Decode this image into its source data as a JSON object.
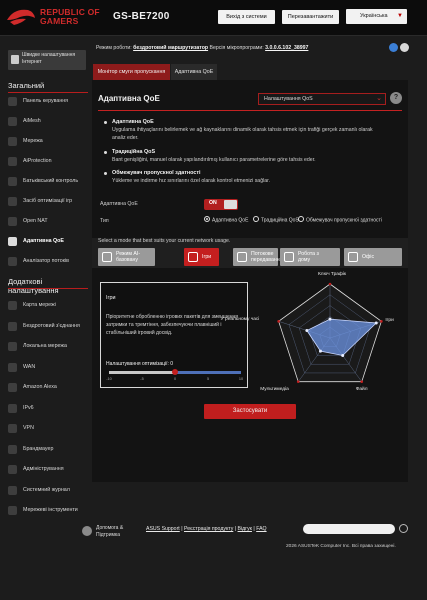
{
  "header": {
    "logo_line1": "REPUBLIC OF",
    "logo_line2": "GAMERS",
    "model": "GS-BE7200",
    "logout_label": "Вихід з системи",
    "reboot_label": "Перезавантажити",
    "language": "Українська"
  },
  "sidebar": {
    "first_item": "Швидке налаштування Інтернет",
    "general_heading": "Загальний",
    "general_items": [
      {
        "label": "Панель керування",
        "icon": "dashboard-icon"
      },
      {
        "label": "AiMesh",
        "icon": "aimesh-icon"
      },
      {
        "label": "Мережа",
        "icon": "network-icon"
      },
      {
        "label": "AiProtection",
        "icon": "shield-icon"
      },
      {
        "label": "Батьківський контроль",
        "icon": "parental-icon"
      },
      {
        "label": "Засіб оптимізації ігр",
        "icon": "game-boost-icon"
      },
      {
        "label": "Open NAT",
        "icon": "open-nat-icon"
      },
      {
        "label": "Адаптивна QoE",
        "icon": "qos-icon",
        "active": true
      },
      {
        "label": "Аналізатор потоків",
        "icon": "traffic-analyzer-icon"
      }
    ],
    "advanced_heading_1": "Додаткові",
    "advanced_heading_2": "налаштування",
    "advanced_items": [
      {
        "label": "Карта мережі",
        "icon": "network-map-icon"
      },
      {
        "label": "Бездротовий з'єднання",
        "icon": "wireless-icon"
      },
      {
        "label": "Локальна мережа",
        "icon": "lan-icon"
      },
      {
        "label": "WAN",
        "icon": "wan-icon"
      },
      {
        "label": "Amazon Alexa",
        "icon": "alexa-icon"
      },
      {
        "label": "IPv6",
        "icon": "ipv6-icon"
      },
      {
        "label": "VPN",
        "icon": "vpn-icon"
      },
      {
        "label": "Брандмауер",
        "icon": "firewall-icon"
      },
      {
        "label": "Адміністрування",
        "icon": "admin-icon"
      },
      {
        "label": "Системний журнал",
        "icon": "syslog-icon"
      },
      {
        "label": "Мережеві інструменти",
        "icon": "tools-icon"
      }
    ]
  },
  "status": {
    "mode_label": "Режим роботи:",
    "mode_value": "бездротовий маршрутизатор",
    "fw_label": "Версія мікропрограми:",
    "fw_value": "3.0.0.6.102_38997",
    "icon_colors": [
      "#3b7fd6",
      "#d8d8d8"
    ]
  },
  "tabs": [
    {
      "label": "Монітор смуги пропускання"
    },
    {
      "label": "Адаптивна QoE"
    }
  ],
  "main": {
    "title": "Адаптивна QoE",
    "qos_select": "Налаштування QoS",
    "help": "?",
    "desc": [
      {
        "h": "Адаптивна QoE",
        "b": "Uygulama ihtiyaçlarını belirlemek ve ağ kaynaklarını dinamik olarak tahsis etmek için trafiği gerçek zamanlı olarak analiz eder."
      },
      {
        "h": "Традиційна QoS",
        "b": "Bant genişliğini, manuel olarak yapılandırılmış kullanıcı parametrelerine göre tahsis eder."
      },
      {
        "h": "Обмежувач пропускної здатності",
        "b": "Yükleme ve indirme hız sınırlarını özel olarak kontrol etmenizi sağlar."
      }
    ],
    "enable_label": "Адаптивна QoE",
    "toggle_text": "ON",
    "type_label": "Тип",
    "radios": [
      "Адаптивна QoE",
      "Традиційна QoS",
      "Обмежувач пропускної здатності"
    ],
    "mode_caption": "Select a mode that best suits your current network usage.",
    "modes": [
      {
        "l1": "Режим AI-",
        "l2": "базовану",
        "icon": "ai-mode-icon"
      },
      {
        "l1": "Ігри",
        "l2": "",
        "icon": "gamepad-icon",
        "selected": true
      },
      {
        "l1": "Потокове",
        "l2": "передавання",
        "icon": "streaming-icon"
      },
      {
        "l1": "Робота з",
        "l2": "дому",
        "icon": "home-work-icon"
      },
      {
        "l1": "Офіс",
        "l2": "",
        "icon": "office-icon"
      }
    ],
    "game_title": "Ігри",
    "game_desc": "Пріоритетне обробленню ігрових пакетів для зменшення затримки та тремтіння, забезпечуючи плавніший і стабільніший ігровий досвід.",
    "opt_label": "Налаштування оптимізації: 0",
    "slider_value": 0,
    "slider_min": -10,
    "slider_max": 10,
    "slider_ticks": [
      "-10",
      "-5",
      "0",
      "5",
      "10"
    ],
    "radar_labels": [
      "Ключ Трафік",
      "Ігри",
      "Файл",
      "Мультимедіа",
      "У реальному часі"
    ],
    "radar_values": [
      0.35,
      0.9,
      0.4,
      0.3,
      0.45
    ],
    "apply_label": "Застосувати"
  },
  "footer": {
    "help_line1": "Допомога &",
    "help_line2": "Підтримка",
    "links": [
      "ASUS Support",
      "Реєстрація продукту",
      "Відгук",
      "FAQ"
    ],
    "copyright": "2026 ASUSTeK Computer Inc. Всі права захищені."
  },
  "colors": {
    "accent": "#c41f1f",
    "bg": "#1c1c1c",
    "panel": "#131313"
  }
}
